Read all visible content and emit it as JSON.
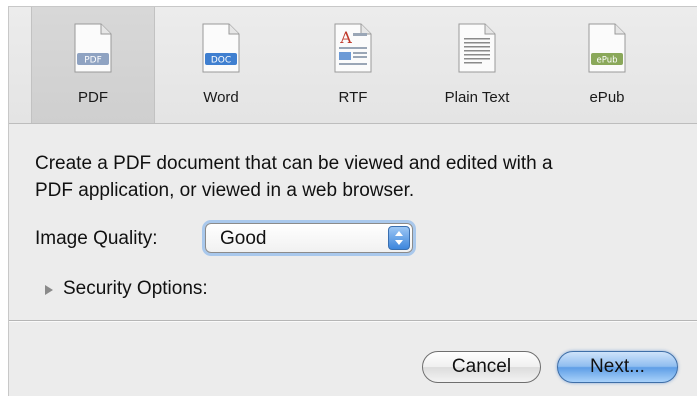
{
  "toolbar": {
    "formats": [
      {
        "label": "PDF",
        "badge": "PDF",
        "selected": true
      },
      {
        "label": "Word",
        "badge": "DOC",
        "selected": false
      },
      {
        "label": "RTF",
        "badge": "A",
        "selected": false
      },
      {
        "label": "Plain Text",
        "badge": "",
        "selected": false
      },
      {
        "label": "ePub",
        "badge": "ePub",
        "selected": false
      }
    ]
  },
  "content": {
    "description_line1": "Create a PDF document that can be viewed and edited with a",
    "description_line2": "PDF application, or viewed in a web browser.",
    "image_quality_label": "Image Quality:",
    "image_quality_value": "Good",
    "security_options_label": "Security Options:"
  },
  "buttons": {
    "cancel": "Cancel",
    "next": "Next..."
  },
  "colors": {
    "accent": "#5e9ee6",
    "focus_ring": "#a9c8ec"
  }
}
